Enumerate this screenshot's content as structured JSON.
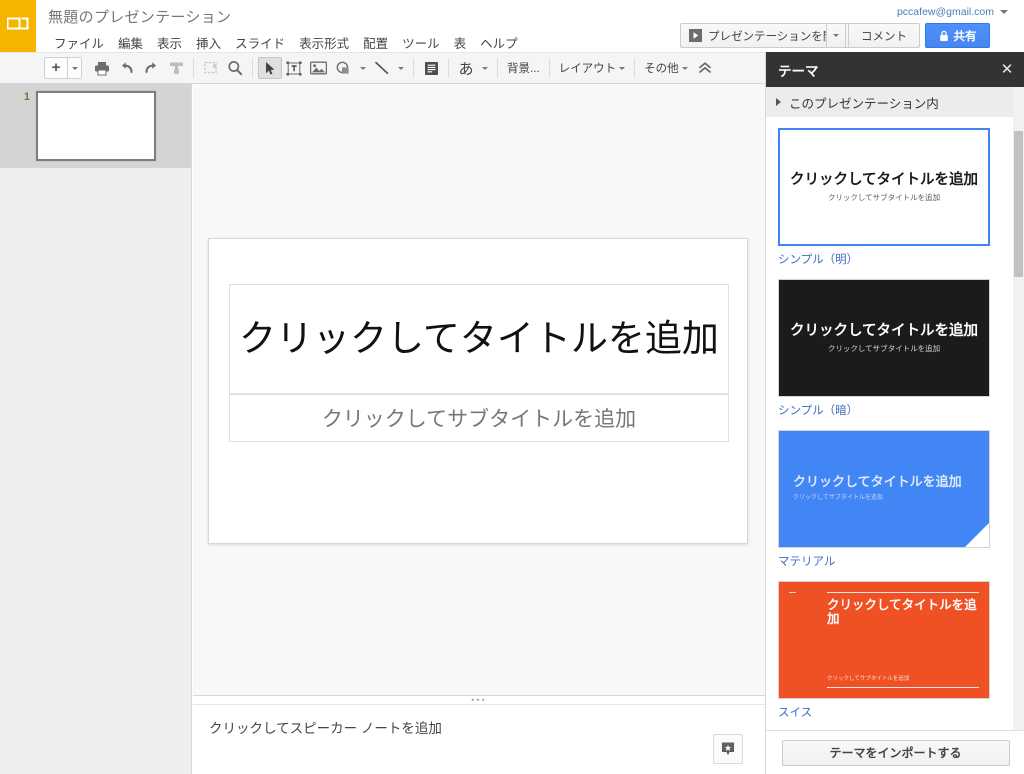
{
  "app": {
    "logo_icon": "google-slides-icon",
    "doc_title": "無題のプレゼンテーション",
    "account_email": "pccafew@gmail.com"
  },
  "menubar": {
    "items": [
      {
        "label": "ファイル"
      },
      {
        "label": "編集"
      },
      {
        "label": "表示"
      },
      {
        "label": "挿入"
      },
      {
        "label": "スライド"
      },
      {
        "label": "表示形式"
      },
      {
        "label": "配置"
      },
      {
        "label": "ツール"
      },
      {
        "label": "表"
      },
      {
        "label": "ヘルプ"
      }
    ]
  },
  "header_buttons": {
    "present_label": "プレゼンテーションを開始",
    "comment_label": "コメント",
    "share_label": "共有"
  },
  "toolbar": {
    "new_slide_label": "+",
    "background_label": "背景...",
    "layout_label": "レイアウト",
    "other_label": "その他",
    "theme_font_label": "あ",
    "icons": [
      "new-slide-icon",
      "print-icon",
      "undo-icon",
      "redo-icon",
      "paint-format-icon",
      "zoom-fit-icon",
      "zoom-icon",
      "select-icon",
      "textbox-icon",
      "image-icon",
      "shape-icon",
      "line-icon",
      "theme-panel-icon",
      "collapse-toolbar-icon"
    ]
  },
  "filmstrip": {
    "slides": [
      {
        "number": "1",
        "selected": true
      }
    ]
  },
  "slide": {
    "title_placeholder": "クリックしてタイトルを追加",
    "subtitle_placeholder": "クリックしてサブタイトルを追加"
  },
  "notes": {
    "placeholder": "クリックしてスピーカー ノートを追加",
    "button_icon": "speaker-notes-icon"
  },
  "theme_panel": {
    "title": "テーマ",
    "close_icon": "close-icon",
    "section_label": "このプレゼンテーション内",
    "import_label": "テーマをインポートする",
    "themes": [
      {
        "name": "シンプル（明）",
        "style": "simple-light",
        "selected": true,
        "title": "クリックしてタイトルを追加",
        "subtitle": "クリックしてサブタイトルを追加"
      },
      {
        "name": "シンプル（暗）",
        "style": "simple-dark",
        "selected": false,
        "title": "クリックしてタイトルを追加",
        "subtitle": "クリックしてサブタイトルを追加"
      },
      {
        "name": "マテリアル",
        "style": "material",
        "selected": false,
        "title": "クリックしてタイトルを追加",
        "subtitle": "クリックしてサブタイトルを追加"
      },
      {
        "name": "スイス",
        "style": "swiss",
        "selected": false,
        "title": "クリックしてタイトルを追加",
        "subtitle": "クリックしてサブタイトルを追加"
      }
    ]
  },
  "colors": {
    "brand_yellow": "#f4b400",
    "share_blue": "#4d90fe",
    "panel_dark": "#333333",
    "selection_blue": "#4285f4",
    "material_blue": "#4285f4",
    "swiss_orange": "#ef5125"
  }
}
